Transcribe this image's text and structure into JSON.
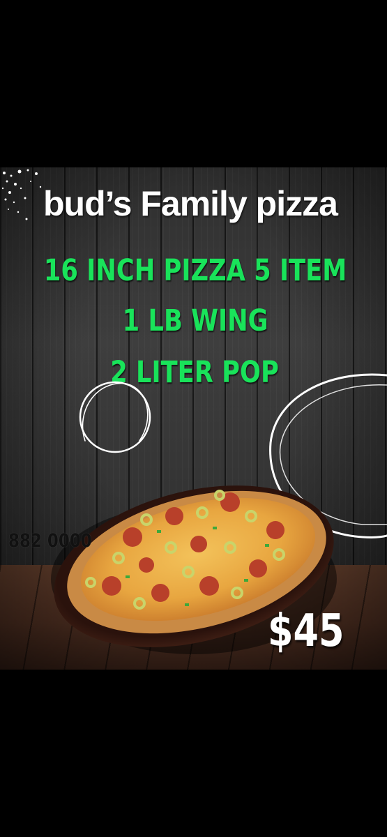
{
  "flyer": {
    "title": "bud’s Family pizza",
    "offer_lines": [
      "16 INCH PIZZA 5 ITEM",
      "1 LB WING",
      "2 LITER POP"
    ],
    "phone": "882 0000",
    "price": "$45"
  },
  "colors": {
    "background": "#000000",
    "offer_green": "#19e35a",
    "title_white": "#ffffff",
    "phone_dark": "#111111"
  },
  "icons": [
    "sparkle-dots-icon",
    "chalk-ring-icon",
    "pizza-image"
  ]
}
